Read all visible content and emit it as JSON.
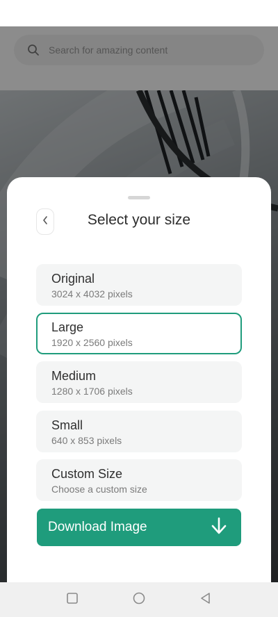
{
  "search": {
    "placeholder": "Search for amazing content"
  },
  "sheet": {
    "title": "Select your size",
    "options": [
      {
        "name": "Original",
        "detail": "3024 x 4032 pixels"
      },
      {
        "name": "Large",
        "detail": "1920 x 2560 pixels",
        "selected": true
      },
      {
        "name": "Medium",
        "detail": "1280 x 1706 pixels"
      },
      {
        "name": "Small",
        "detail": "640 x 853 pixels"
      },
      {
        "name": "Custom Size",
        "detail": "Choose a custom size"
      }
    ],
    "download_label": "Download Image"
  },
  "icons": {
    "search": "search-icon",
    "back": "chevron-left-icon",
    "download": "arrow-down-icon",
    "nav": [
      "square-recents-icon",
      "circle-home-icon",
      "triangle-back-icon"
    ]
  },
  "colors": {
    "accent": "#1f9c7c",
    "option_bg": "#f4f5f5",
    "overlay": "rgba(0,0,0,0.45)"
  }
}
